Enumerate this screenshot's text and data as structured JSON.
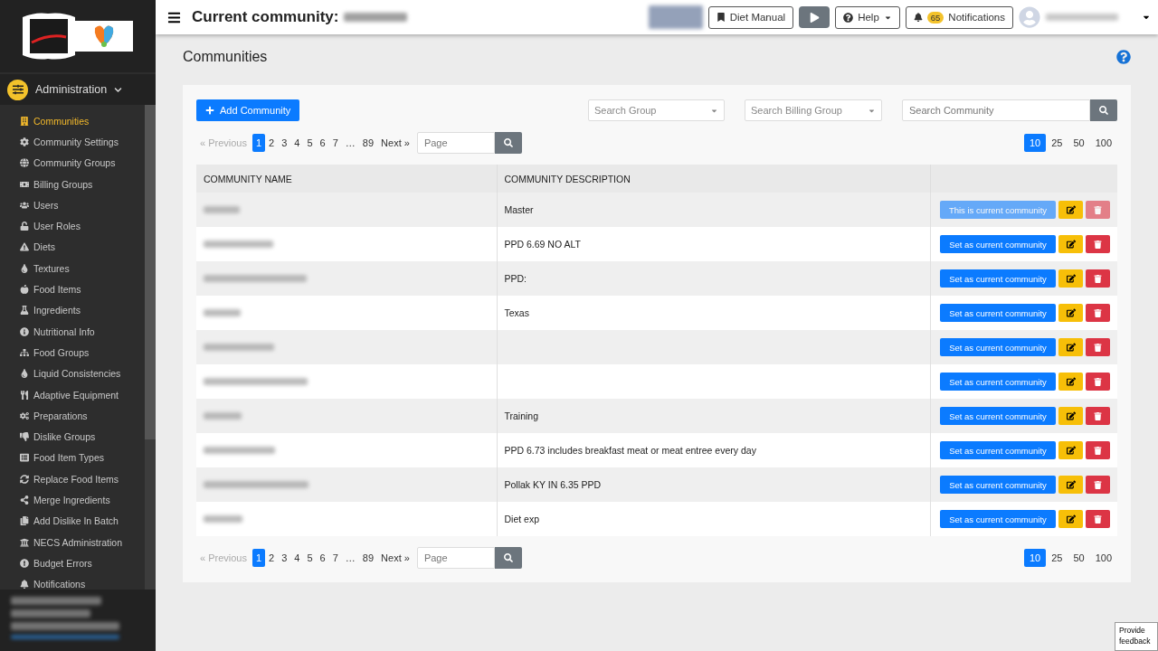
{
  "sidebar": {
    "section": {
      "label": "Administration",
      "expanded": true
    },
    "items": [
      {
        "label": "Communities",
        "selected": true
      },
      {
        "label": "Community Settings",
        "selected": false
      },
      {
        "label": "Community Groups",
        "selected": false
      },
      {
        "label": "Billing Groups",
        "selected": false
      },
      {
        "label": "Users",
        "selected": false
      },
      {
        "label": "User Roles",
        "selected": false
      },
      {
        "label": "Diets",
        "selected": false
      },
      {
        "label": "Textures",
        "selected": false
      },
      {
        "label": "Food Items",
        "selected": false
      },
      {
        "label": "Ingredients",
        "selected": false
      },
      {
        "label": "Nutritional Info",
        "selected": false
      },
      {
        "label": "Food Groups",
        "selected": false
      },
      {
        "label": "Liquid Consistencies",
        "selected": false
      },
      {
        "label": "Adaptive Equipment",
        "selected": false
      },
      {
        "label": "Preparations",
        "selected": false
      },
      {
        "label": "Dislike Groups",
        "selected": false
      },
      {
        "label": "Food Item Types",
        "selected": false
      },
      {
        "label": "Replace Food Items",
        "selected": false
      },
      {
        "label": "Merge Ingredients",
        "selected": false
      },
      {
        "label": "Add Dislike In Batch",
        "selected": false
      },
      {
        "label": "NECS Administration",
        "selected": false
      },
      {
        "label": "Budget Errors",
        "selected": false
      },
      {
        "label": "Notifications",
        "selected": false
      }
    ]
  },
  "topbar": {
    "title": "Current community:",
    "diet_manual": "Diet Manual",
    "help": "Help",
    "notifications": {
      "count": "65",
      "label": "Notifications"
    }
  },
  "page": {
    "title": "Communities"
  },
  "toolbar": {
    "add_button": "Add Community",
    "search_group": {
      "placeholder": "Search Group"
    },
    "search_billing": {
      "placeholder": "Search Billing Group"
    },
    "search_community": {
      "placeholder": "Search Community"
    }
  },
  "pagination": [
    {
      "previous": "« Previous",
      "next": "Next »",
      "pages": [
        {
          "label": "1",
          "selected": true
        },
        {
          "label": "2",
          "selected": false
        },
        {
          "label": "3",
          "selected": false
        },
        {
          "label": "4",
          "selected": false
        },
        {
          "label": "5",
          "selected": false
        },
        {
          "label": "6",
          "selected": false
        },
        {
          "label": "7",
          "selected": false
        },
        {
          "label": "…",
          "selected": false
        },
        {
          "label": "89",
          "selected": false
        }
      ],
      "page_field": {
        "placeholder": "Page"
      },
      "page_sizes": [
        {
          "label": "10",
          "selected": true
        },
        {
          "label": "25",
          "selected": false
        },
        {
          "label": "50",
          "selected": false
        },
        {
          "label": "100",
          "selected": false
        }
      ]
    },
    {
      "previous": "« Previous",
      "next": "Next »",
      "pages": [
        {
          "label": "1",
          "selected": true
        },
        {
          "label": "2",
          "selected": false
        },
        {
          "label": "3",
          "selected": false
        },
        {
          "label": "4",
          "selected": false
        },
        {
          "label": "5",
          "selected": false
        },
        {
          "label": "6",
          "selected": false
        },
        {
          "label": "7",
          "selected": false
        },
        {
          "label": "…",
          "selected": false
        },
        {
          "label": "89",
          "selected": false
        }
      ],
      "page_field": {
        "placeholder": "Page"
      },
      "page_sizes": [
        {
          "label": "10",
          "selected": true
        },
        {
          "label": "25",
          "selected": false
        },
        {
          "label": "50",
          "selected": false
        },
        {
          "label": "100",
          "selected": false
        }
      ]
    }
  ],
  "table": {
    "columns": [
      "COMMUNITY NAME",
      "COMMUNITY DESCRIPTION"
    ],
    "rows": [
      {
        "description": "Master",
        "action": "This is current community",
        "current": true
      },
      {
        "description": "PPD 6.69 NO ALT",
        "action": "Set as current community",
        "current": false
      },
      {
        "description": "PPD:",
        "action": "Set as current community",
        "current": false
      },
      {
        "description": "Texas",
        "action": "Set as current community",
        "current": false
      },
      {
        "action": "Set as current community",
        "current": false
      },
      {
        "action": "Set as current community",
        "current": false
      },
      {
        "description": "Training",
        "action": "Set as current community",
        "current": false
      },
      {
        "description": "PPD 6.73 includes breakfast meat or meat entree every day",
        "action": "Set as current community",
        "current": false
      },
      {
        "description": "Pollak KY IN 6.35 PPD",
        "action": "Set as current community",
        "current": false
      },
      {
        "description": "Diet exp",
        "action": "Set as current community",
        "current": false
      }
    ]
  },
  "feedback": "Provide feedback"
}
